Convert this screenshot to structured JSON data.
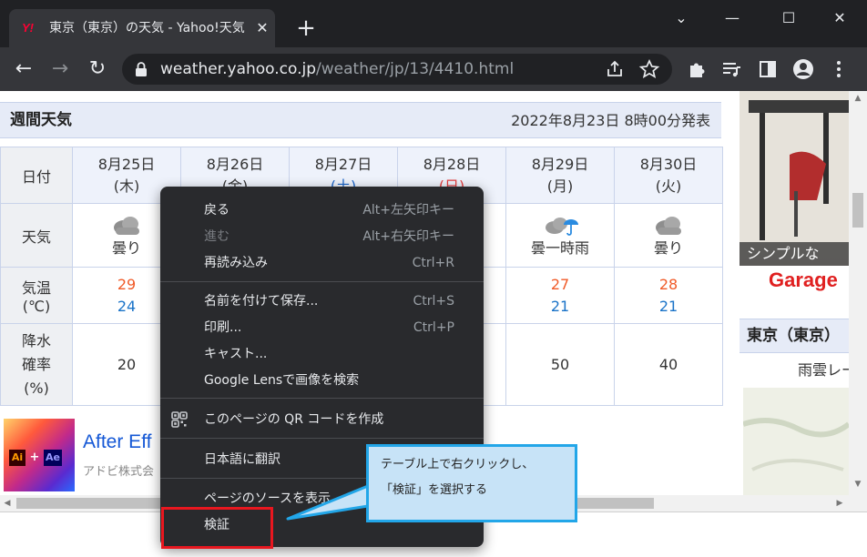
{
  "browser": {
    "tab": {
      "favicon": "Y!",
      "title": "東京（東京）の天気 - Yahoo!天気",
      "close": "✕"
    },
    "new_tab": "+",
    "window_controls": {
      "dropdown": "⌄",
      "minimize": "—",
      "maximize": "☐",
      "close": "✕"
    },
    "nav": {
      "back": "←",
      "forward": "→",
      "reload": "↻"
    },
    "url_host": "weather.yahoo.co.jp",
    "url_path": "/weather/jp/13/4410.html",
    "icons": [
      "share-icon",
      "bookmark-star-icon",
      "extensions-icon",
      "media-icon",
      "side-panel-icon",
      "profile-icon",
      "menu-icon"
    ]
  },
  "forecast": {
    "title": "週間天気",
    "issued": "2022年8月23日 8時00分発表",
    "row_labels": {
      "date": "日付",
      "weather": "天気",
      "temp_1": "気温",
      "temp_2": "(℃)",
      "pop_1": "降水",
      "pop_2": "確率",
      "pop_3": "(%)"
    },
    "days": [
      {
        "date": "8月25日",
        "dow": "(木)",
        "weather": "曇り",
        "icon": "cloud-icon",
        "high": "29",
        "low": "24",
        "pop": "20"
      },
      {
        "date": "8月26日",
        "dow": "(金)",
        "weather": "",
        "icon": "",
        "high": "",
        "low": "",
        "pop": ""
      },
      {
        "date": "8月27日",
        "dow": "(土)",
        "weather": "",
        "icon": "",
        "high": "",
        "low": "",
        "pop": ""
      },
      {
        "date": "8月28日",
        "dow": "(日)",
        "weather": "",
        "icon": "",
        "high": "",
        "low": "",
        "pop": ""
      },
      {
        "date": "8月29日",
        "dow": "(月)",
        "weather": "曇一時雨",
        "icon": "cloud-rain-icon",
        "high": "27",
        "low": "21",
        "pop": "50"
      },
      {
        "date": "8月30日",
        "dow": "(火)",
        "weather": "曇り",
        "icon": "cloud-icon",
        "high": "28",
        "low": "21",
        "pop": "40"
      }
    ]
  },
  "ad": {
    "title": "After Eff",
    "subtitle": "アドビ株式会",
    "badge_ai": "Ai",
    "badge_plus": "+",
    "badge_ae": "Ae"
  },
  "sidebar": {
    "ad_text": "シンプルな",
    "ad_brand": "Garage",
    "heading": "東京（東京）",
    "sub": "雨雲レー"
  },
  "context_menu": {
    "items": [
      {
        "label": "戻る",
        "shortcut": "Alt+左矢印キー",
        "disabled": false
      },
      {
        "label": "進む",
        "shortcut": "Alt+右矢印キー",
        "disabled": true
      },
      {
        "label": "再読み込み",
        "shortcut": "Ctrl+R",
        "disabled": false
      },
      {
        "label": "名前を付けて保存...",
        "shortcut": "Ctrl+S",
        "disabled": false
      },
      {
        "label": "印刷...",
        "shortcut": "Ctrl+P",
        "disabled": false
      },
      {
        "label": "キャスト...",
        "shortcut": "",
        "disabled": false
      },
      {
        "label": "Google Lensで画像を検索",
        "shortcut": "",
        "disabled": false
      },
      {
        "label": "このページの QR コードを作成",
        "shortcut": "",
        "disabled": false
      },
      {
        "label": "日本語に翻訳",
        "shortcut": "",
        "disabled": false
      },
      {
        "label": "ページのソースを表示",
        "shortcut": "",
        "disabled": false
      },
      {
        "label": "検証",
        "shortcut": "",
        "disabled": false
      }
    ]
  },
  "callout": {
    "line1": "テーブル上で右クリックし、",
    "line2": "「検証」を選択する"
  },
  "colors": {
    "highlight": "#e8171f",
    "callout_border": "#22a6e8",
    "callout_bg": "#c7e3f7",
    "temp_high": "#f05a28",
    "temp_low": "#1a73c8"
  }
}
